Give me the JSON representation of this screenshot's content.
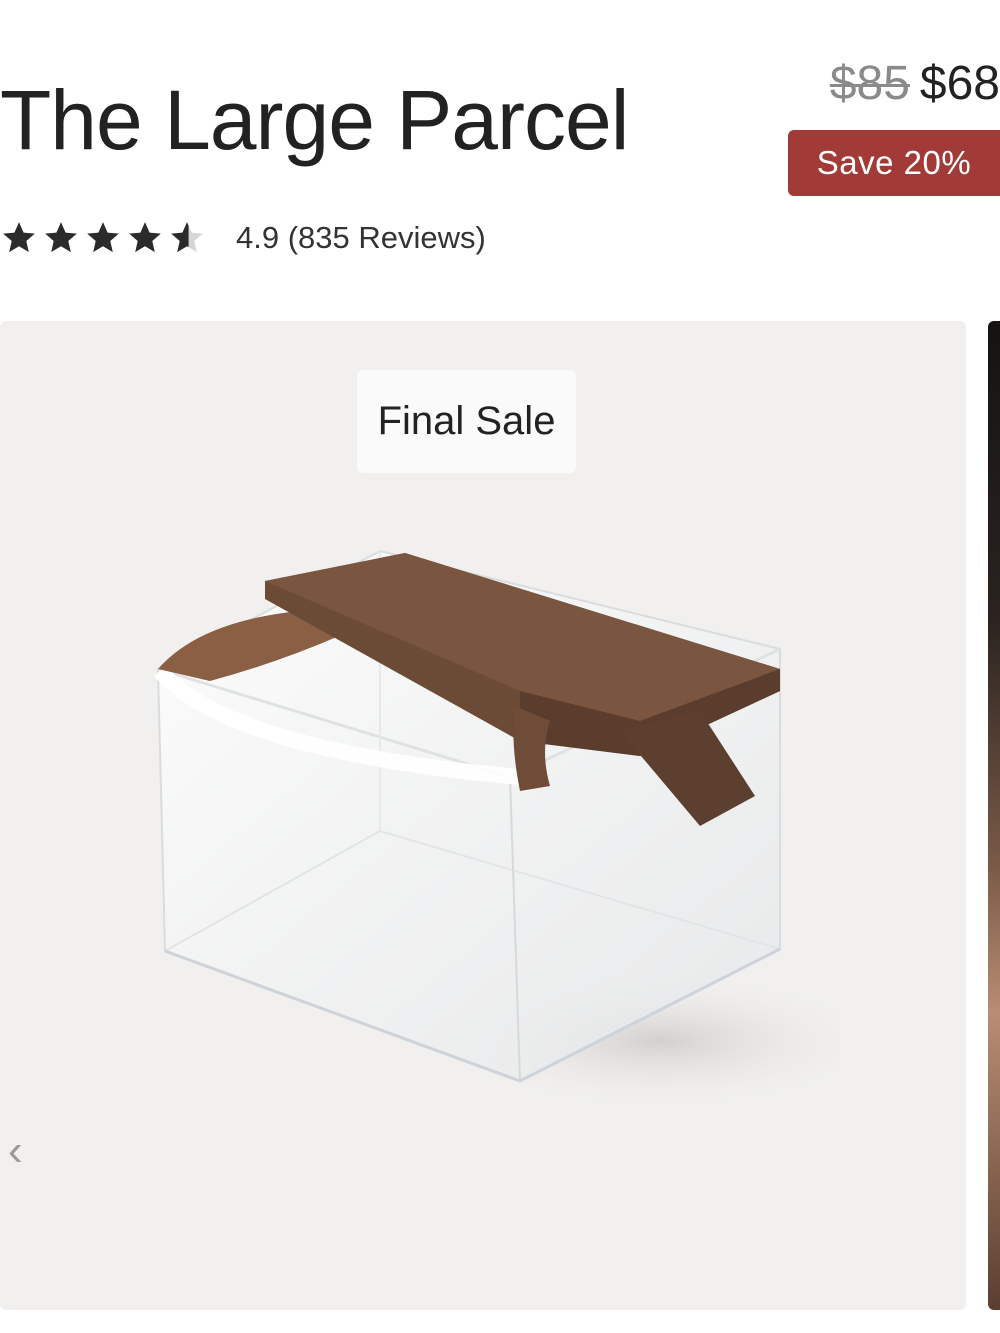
{
  "product": {
    "title": "The Large Parcel",
    "price_original": "$85",
    "price_sale": "$68",
    "save_badge": "Save 20%",
    "rating_text": "4.9 (835 Reviews)",
    "rating": 4.9,
    "rating_max": 5
  },
  "gallery": {
    "badge_label": "Final Sale",
    "prev_arrow": "‹",
    "next_arrow": "›",
    "image_icon": "clear-toiletry-bag-image"
  },
  "colors": {
    "sale_badge": "#a23a37",
    "strap_brown": "#6b4a36",
    "gallery_bg": "#f1f0ee"
  }
}
